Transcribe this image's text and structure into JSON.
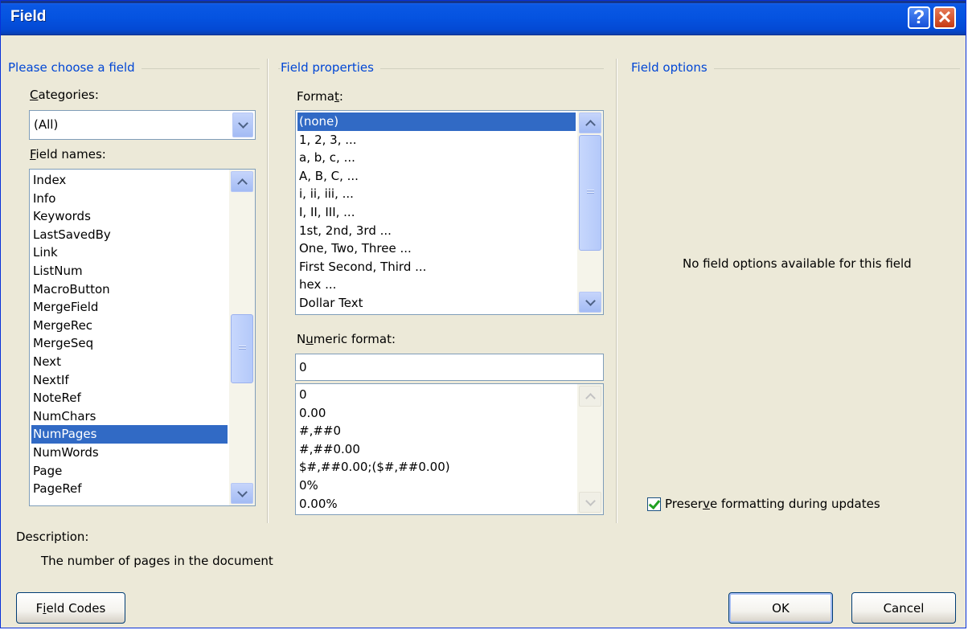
{
  "window": {
    "title": "Field",
    "help_label": "?",
    "close_label": "✕"
  },
  "left_group": {
    "title": "Please choose a field",
    "categories_label_first": "C",
    "categories_label_rest": "ategories:",
    "categories_value": "(All)",
    "field_names_label_first": "F",
    "field_names_label_rest": "ield names:",
    "field_names": [
      "Index",
      "Info",
      "Keywords",
      "LastSavedBy",
      "Link",
      "ListNum",
      "MacroButton",
      "MergeField",
      "MergeRec",
      "MergeSeq",
      "Next",
      "NextIf",
      "NoteRef",
      "NumChars",
      "NumPages",
      "NumWords",
      "Page",
      "PageRef"
    ],
    "selected_field": "NumPages"
  },
  "middle_group": {
    "title": "Field properties",
    "format_label_before": "Forma",
    "format_label_u": "t",
    "format_label_after": ":",
    "formats": [
      "(none)",
      "1, 2, 3, ...",
      "a, b, c, ...",
      "A, B, C, ...",
      "i, ii, iii, ...",
      "I, II, III, ...",
      "1st, 2nd, 3rd ...",
      "One, Two, Three ...",
      "First Second, Third ...",
      "hex ...",
      "Dollar Text"
    ],
    "selected_format": "(none)",
    "numeric_label_before": "N",
    "numeric_label_u": "u",
    "numeric_label_after": "meric format:",
    "numeric_value": "0",
    "numeric_formats": [
      "0",
      "0.00",
      "#,##0",
      "#,##0.00",
      "$#,##0.00;($#,##0.00)",
      "0%",
      "0.00%"
    ]
  },
  "right_group": {
    "title": "Field options",
    "empty_message": "No field options available for this field",
    "preserve_before": "Preser",
    "preserve_u": "v",
    "preserve_after": "e formatting during updates",
    "preserve_checked": true
  },
  "description": {
    "label": "Description:",
    "text": "The number of pages in the document"
  },
  "buttons": {
    "field_codes_before": "F",
    "field_codes_u": "i",
    "field_codes_after": "eld Codes",
    "ok": "OK",
    "cancel": "Cancel"
  },
  "icons": {
    "help": "help-icon",
    "close": "close-icon",
    "dropdown": "chevron-down-icon",
    "scroll_up": "chevron-up-icon",
    "scroll_down": "chevron-down-icon",
    "check": "check-icon"
  }
}
